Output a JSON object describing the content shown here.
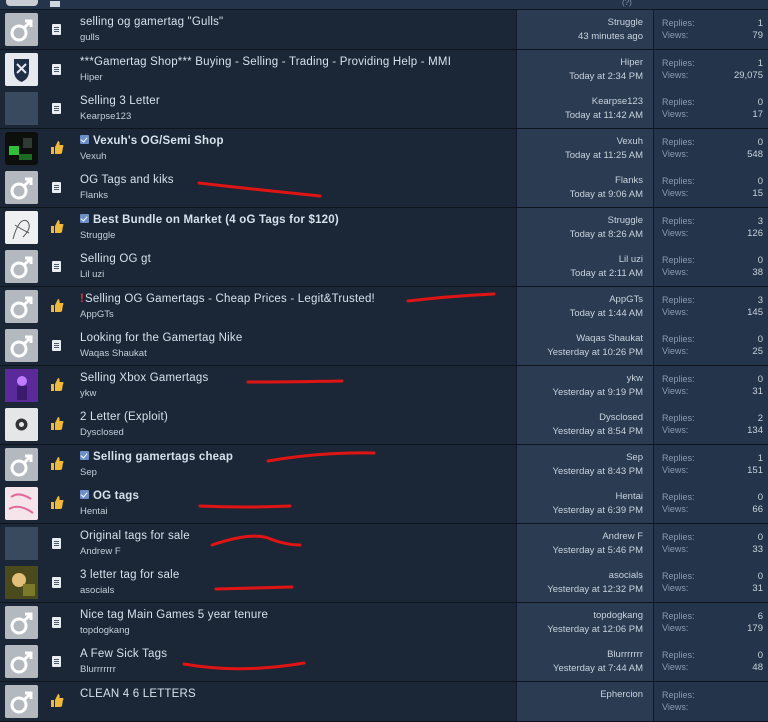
{
  "labels": {
    "replies": "Replies:",
    "views": "Views:"
  },
  "prev_row_tail": "(?)",
  "threads": [
    {
      "title": "selling og gamertag \"Gulls\"",
      "author": "gulls",
      "last_user": "Struggle",
      "last_time": "43 minutes ago",
      "replies": "1",
      "views": "79",
      "avatar": "default-male",
      "prefix": "document-icon",
      "bold": false,
      "checked": false,
      "bang": false
    },
    {
      "title": "***Gamertag Shop*** Buying - Selling - Trading - Providing Help - MMI",
      "author": "Hiper",
      "last_user": "Hiper",
      "last_time": "Today at 2:34 PM",
      "replies": "1",
      "views": "29,075",
      "avatar": "shield-logo",
      "prefix": "document-icon",
      "bold": false,
      "checked": false,
      "bang": false
    },
    {
      "title": "Selling 3 Letter",
      "author": "Kearpse123",
      "last_user": "Kearpse123",
      "last_time": "Today at 11:42 AM",
      "replies": "0",
      "views": "17",
      "avatar": "blank",
      "prefix": "document-icon",
      "bold": false,
      "checked": false,
      "bang": false
    },
    {
      "title": "Vexuh's OG/Semi Shop",
      "author": "Vexuh",
      "last_user": "Vexuh",
      "last_time": "Today at 11:25 AM",
      "replies": "0",
      "views": "548",
      "avatar": "dark-photo",
      "prefix": "thumbs-up-icon",
      "bold": true,
      "checked": true,
      "bang": false
    },
    {
      "title": "OG Tags and kiks",
      "author": "Flanks",
      "last_user": "Flanks",
      "last_time": "Today at 9:06 AM",
      "replies": "0",
      "views": "15",
      "avatar": "default-male",
      "prefix": "document-icon",
      "bold": false,
      "checked": false,
      "bang": false
    },
    {
      "title": "Best Bundle on Market (4 oG Tags for $120)",
      "author": "Struggle",
      "last_user": "Struggle",
      "last_time": "Today at 8:26 AM",
      "replies": "3",
      "views": "126",
      "avatar": "sketch",
      "prefix": "thumbs-up-icon",
      "bold": true,
      "checked": true,
      "bang": false
    },
    {
      "title": "Selling OG gt",
      "author": "Lil uzi",
      "last_user": "Lil uzi",
      "last_time": "Today at 2:11 AM",
      "replies": "0",
      "views": "38",
      "avatar": "default-male",
      "prefix": "document-icon",
      "bold": false,
      "checked": false,
      "bang": false
    },
    {
      "title": "Selling OG Gamertags - Cheap Prices - Legit&Trusted!",
      "author": "AppGTs",
      "last_user": "AppGTs",
      "last_time": "Today at 1:44 AM",
      "replies": "3",
      "views": "145",
      "avatar": "default-male",
      "prefix": "thumbs-up-icon",
      "bold": false,
      "checked": false,
      "bang": true
    },
    {
      "title": "Looking for the Gamertag Nike",
      "author": "Waqas Shaukat",
      "last_user": "Waqas Shaukat",
      "last_time": "Yesterday at 10:26 PM",
      "replies": "0",
      "views": "25",
      "avatar": "default-male",
      "prefix": "document-icon",
      "bold": false,
      "checked": false,
      "bang": false
    },
    {
      "title": "Selling Xbox Gamertags",
      "author": "ykw",
      "last_user": "ykw",
      "last_time": "Yesterday at 9:19 PM",
      "replies": "0",
      "views": "31",
      "avatar": "purple-photo",
      "prefix": "thumbs-up-icon",
      "bold": false,
      "checked": false,
      "bang": false
    },
    {
      "title": "2 Letter (Exploit)",
      "author": "Dysclosed",
      "last_user": "Dysclosed",
      "last_time": "Yesterday at 8:54 PM",
      "replies": "2",
      "views": "134",
      "avatar": "round-logo",
      "prefix": "thumbs-up-icon",
      "bold": false,
      "checked": false,
      "bang": false
    },
    {
      "title": "Selling gamertags cheap",
      "author": "Sep",
      "last_user": "Sep",
      "last_time": "Yesterday at 8:43 PM",
      "replies": "1",
      "views": "151",
      "avatar": "default-male",
      "prefix": "thumbs-up-icon",
      "bold": true,
      "checked": true,
      "bang": false
    },
    {
      "title": "OG tags",
      "author": "Hentai",
      "last_user": "Hentai",
      "last_time": "Yesterday at 6:39 PM",
      "replies": "0",
      "views": "66",
      "avatar": "pink-art",
      "prefix": "thumbs-up-icon",
      "bold": true,
      "checked": true,
      "bang": false
    },
    {
      "title": "Original tags for sale",
      "author": "Andrew F",
      "last_user": "Andrew F",
      "last_time": "Yesterday at 5:46 PM",
      "replies": "0",
      "views": "33",
      "avatar": "blank",
      "prefix": "document-icon",
      "bold": false,
      "checked": false,
      "bang": false
    },
    {
      "title": "3 letter tag for sale",
      "author": "asocials",
      "last_user": "asocials",
      "last_time": "Yesterday at 12:32 PM",
      "replies": "0",
      "views": "31",
      "avatar": "olive-photo",
      "prefix": "document-icon",
      "bold": false,
      "checked": false,
      "bang": false
    },
    {
      "title": "Nice tag    Main    Games    5 year tenure",
      "author": "topdogkang",
      "last_user": "topdogkang",
      "last_time": "Yesterday at 12:06 PM",
      "replies": "6",
      "views": "179",
      "avatar": "default-male",
      "prefix": "document-icon",
      "bold": false,
      "checked": false,
      "bang": false
    },
    {
      "title": "A Few Sick Tags",
      "author": "Blurrrrrrr",
      "last_user": "Blurrrrrrr",
      "last_time": "Yesterday at 7:44 AM",
      "replies": "0",
      "views": "48",
      "avatar": "default-male",
      "prefix": "document-icon",
      "bold": false,
      "checked": false,
      "bang": false
    },
    {
      "title": "CLEAN 4 6 LETTERS",
      "author": "",
      "last_user": "Ephercion",
      "last_time": "",
      "replies": "",
      "views": "",
      "avatar": "default-male",
      "prefix": "thumbs-up-icon",
      "bold": false,
      "checked": false,
      "bang": false
    }
  ]
}
